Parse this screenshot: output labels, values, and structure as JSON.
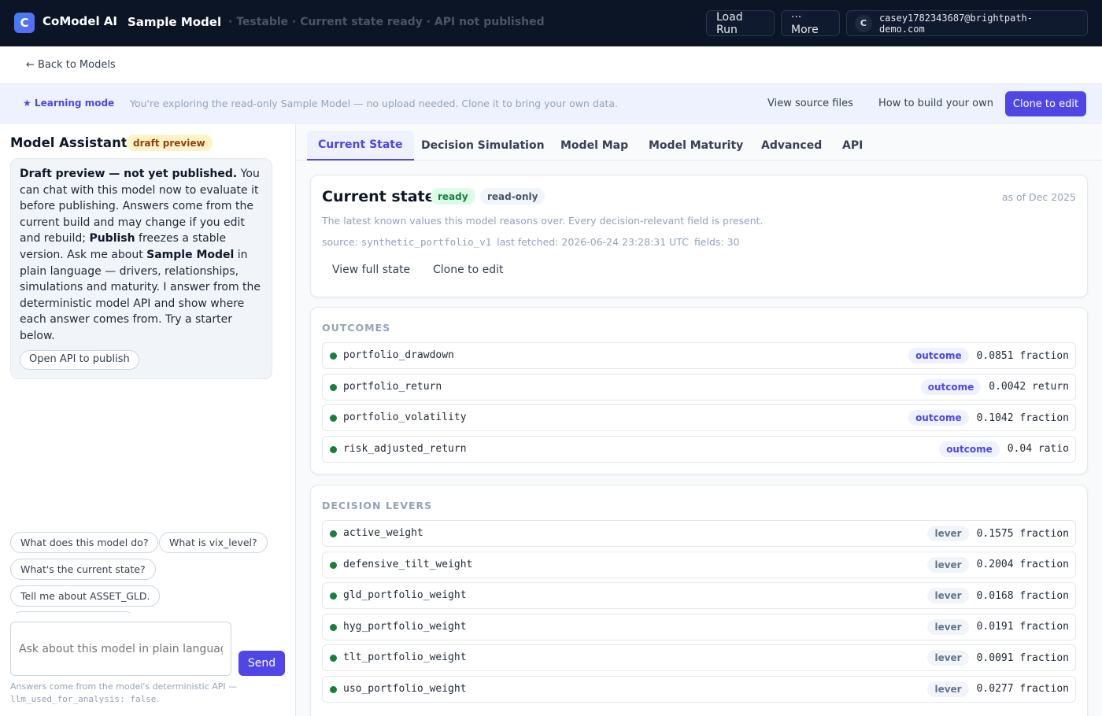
{
  "app": {
    "logo_letter": "C",
    "brand": "CoModel AI",
    "model_name": "Sample Model",
    "model_status": "· Testable · Current state ready · API not published"
  },
  "topbar": {
    "load_run": "Load Run",
    "more": "··· More",
    "user_initial": "C",
    "user_email": "casey1782343687@brightpath-demo.com"
  },
  "nav": {
    "back": "← Back to Models"
  },
  "learning": {
    "title": "★ Learning mode",
    "text": "You're exploring the read-only Sample Model — no upload needed. Clone it to bring your own data.",
    "view_source": "View source files",
    "how_to_build": "How to build your own",
    "clone": "Clone to edit"
  },
  "assistant": {
    "title": "Model Assistant",
    "badge": "draft preview",
    "notice_bold_1": "Draft preview — not yet published.",
    "notice_text_1": " You can chat with this model now to evaluate it before publishing. Answers come from the current build and may change if you edit and rebuild; ",
    "notice_bold_2": "Publish",
    "notice_text_2": " freezes a stable version. Ask me about ",
    "notice_bold_3": "Sample Model",
    "notice_text_3": " in plain language — drivers, relationships, simulations and maturity. I answer from the deterministic model API and show where each answer comes from. Try a starter below.",
    "open_api": "Open API to publish",
    "chips": [
      "What does this model do?",
      "What is vix_level?",
      "What's the current state?",
      "Tell me about ASSET_GLD."
    ],
    "input_placeholder": "Ask about this model in plain language.",
    "send": "Send",
    "foot_text": "Answers come from the model's deterministic API — ",
    "foot_code": "llm_used_for_analysis: false",
    "foot_end": "."
  },
  "tabs": [
    "Current State",
    "Decision Simulation",
    "Model Map",
    "Model Maturity",
    "Advanced",
    "API"
  ],
  "state": {
    "title": "Current state",
    "ready": "ready",
    "readonly": "read-only",
    "as_of": "as of Dec 2025",
    "description": "The latest known values this model reasons over. Every decision-relevant field is present.",
    "source_label": "source:",
    "source_value": "synthetic_portfolio_v1",
    "fetched": "last fetched: 2026-06-24 23:28:31 UTC",
    "fields": "fields: 30",
    "view_full": "View full state",
    "clone": "Clone to edit"
  },
  "outcomes": {
    "label": "OUTCOMES",
    "rows": [
      {
        "name": "portfolio_drawdown",
        "tag": "outcome",
        "value": "0.0851 fraction"
      },
      {
        "name": "portfolio_return",
        "tag": "outcome",
        "value": "0.0042 return"
      },
      {
        "name": "portfolio_volatility",
        "tag": "outcome",
        "value": "0.1042 fraction"
      },
      {
        "name": "risk_adjusted_return",
        "tag": "outcome",
        "value": "0.04 ratio"
      }
    ]
  },
  "levers": {
    "label": "DECISION LEVERS",
    "rows": [
      {
        "name": "active_weight",
        "tag": "lever",
        "value": "0.1575 fraction"
      },
      {
        "name": "defensive_tilt_weight",
        "tag": "lever",
        "value": "0.2004 fraction"
      },
      {
        "name": "gld_portfolio_weight",
        "tag": "lever",
        "value": "0.0168 fraction"
      },
      {
        "name": "hyg_portfolio_weight",
        "tag": "lever",
        "value": "0.0191 fraction"
      },
      {
        "name": "tlt_portfolio_weight",
        "tag": "lever",
        "value": "0.0091 fraction"
      },
      {
        "name": "uso_portfolio_weight",
        "tag": "lever",
        "value": "0.0277 fraction"
      }
    ]
  },
  "colors": {
    "accent": "#4f46e5",
    "topbar": "#0b1526",
    "ready_green": "#15803d",
    "draft_amber": "#fef3c7"
  }
}
